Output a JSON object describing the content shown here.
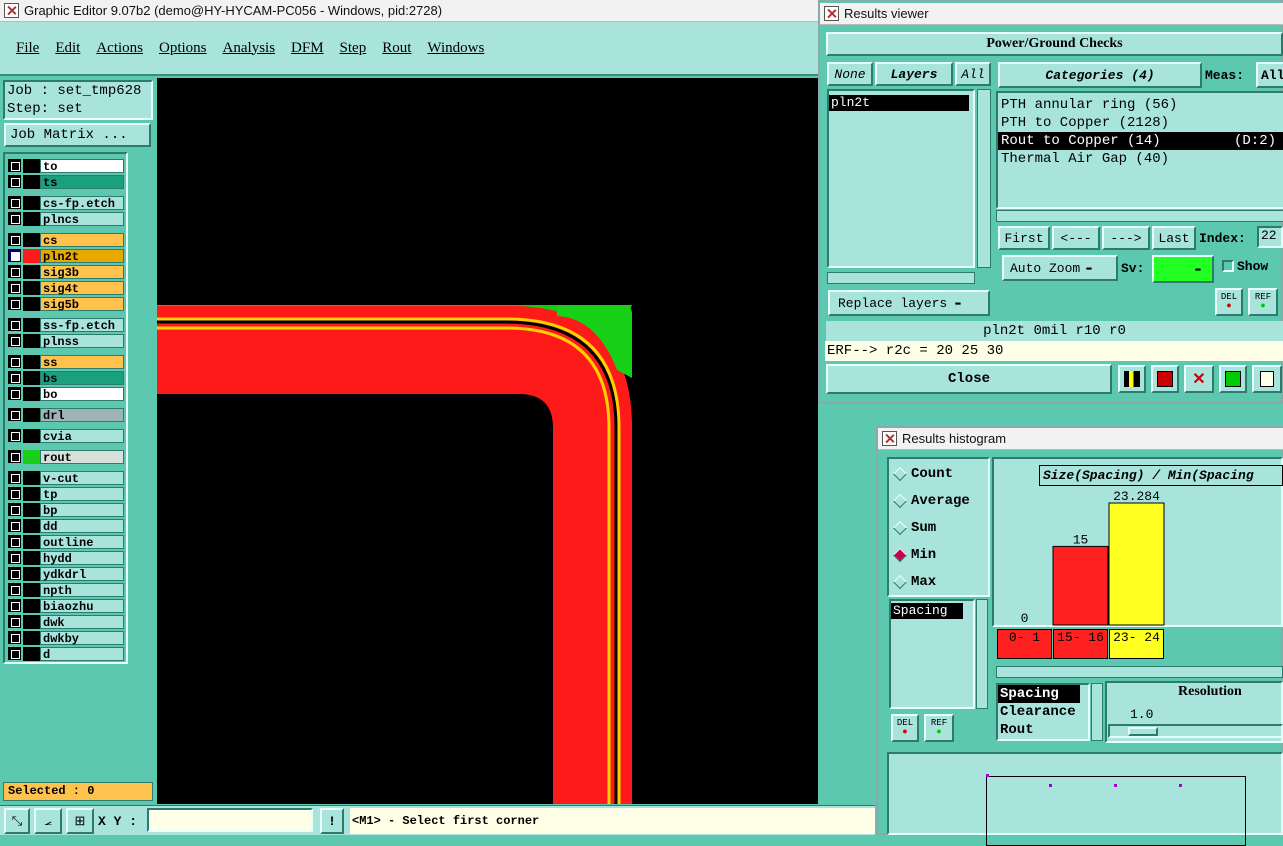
{
  "main_window": {
    "title": "Graphic Editor 9.07b2 (demo@HY-HYCAM-PC056 - Windows, pid:2728)"
  },
  "menu": [
    "File",
    "Edit",
    "Actions",
    "Options",
    "Analysis",
    "DFM",
    "Step",
    "Rout",
    "Windows"
  ],
  "job": {
    "job_label": "Job : set_tmp628",
    "step_label": "Step: set",
    "matrix_button": "Job Matrix ..."
  },
  "layers": [
    {
      "name": "to",
      "color": "#ffffff"
    },
    {
      "name": "ts",
      "color": "#1aa07e"
    },
    {
      "name": "cs-fp.etch",
      "color": "#a8e4db"
    },
    {
      "name": "plncs",
      "color": "#a8e4db"
    },
    {
      "name": "cs",
      "color": "#ffc34d"
    },
    {
      "name": "pln2t",
      "color": "#e8a800",
      "active": true
    },
    {
      "name": "sig3b",
      "color": "#ffc34d"
    },
    {
      "name": "sig4t",
      "color": "#ffc34d"
    },
    {
      "name": "sig5b",
      "color": "#ffc34d"
    },
    {
      "name": "ss-fp.etch",
      "color": "#a8e4db"
    },
    {
      "name": "plnss",
      "color": "#a8e4db"
    },
    {
      "name": "ss",
      "color": "#ffc34d"
    },
    {
      "name": "bs",
      "color": "#1aa07e"
    },
    {
      "name": "bo",
      "color": "#ffffff"
    },
    {
      "name": "drl",
      "color": "#9fb3b8"
    },
    {
      "name": "cvia",
      "color": "#a8e4db"
    },
    {
      "name": "rout",
      "color": "#d8e0dc"
    },
    {
      "name": "v-cut",
      "color": "#a8e4db"
    },
    {
      "name": "tp",
      "color": "#a8e4db"
    },
    {
      "name": "bp",
      "color": "#a8e4db"
    },
    {
      "name": "dd",
      "color": "#a8e4db"
    },
    {
      "name": "outline",
      "color": "#a8e4db"
    },
    {
      "name": "hydd",
      "color": "#a8e4db"
    },
    {
      "name": "ydkdrl",
      "color": "#a8e4db"
    },
    {
      "name": "npth",
      "color": "#a8e4db"
    },
    {
      "name": "biaozhu",
      "color": "#a8e4db"
    },
    {
      "name": "dwk",
      "color": "#a8e4db"
    },
    {
      "name": "dwkby",
      "color": "#a8e4db"
    },
    {
      "name": "d",
      "color": "#a8e4db"
    }
  ],
  "status": {
    "selected": "Selected : 0",
    "xy_label": "X Y :",
    "xy_value": "",
    "prompt": "<M1> - Select first corner"
  },
  "results_viewer": {
    "title": "Results viewer",
    "header": "Power/Ground Checks",
    "btn_none": "None",
    "btn_layers": "Layers",
    "btn_all": "All",
    "layer_list": [
      "pln2t"
    ],
    "categories_label": "Categories (4)",
    "meas_label": "Meas:",
    "meas_value": "All",
    "categories": [
      {
        "text": "PTH annular ring (56)",
        "extra": ""
      },
      {
        "text": "PTH to Copper (2128)",
        "extra": ""
      },
      {
        "text": "Rout to Copper (14)",
        "extra": "(D:2)"
      },
      {
        "text": "Thermal Air Gap (40)",
        "extra": ""
      }
    ],
    "nav": {
      "first": "First",
      "prev": "<---",
      "next": "--->",
      "last": "Last",
      "index_label": "Index:",
      "index_value": "22"
    },
    "auto_zoom": "Auto Zoom",
    "sv_label": "Sv:",
    "show_label": "Show",
    "replace_layers": "Replace layers",
    "del_label": "DEL",
    "ref_label": "REF",
    "info": "pln2t  0mil  r10  r0",
    "erf": "ERF--> r2c = 20 25 30",
    "close": "Close"
  },
  "histogram": {
    "title": "Results histogram",
    "modes": [
      "Count",
      "Average",
      "Sum",
      "Min",
      "Max"
    ],
    "selected_mode": "Min",
    "left_list": [
      "Spacing"
    ],
    "chart_title": "Size(Spacing) / Min(Spacing",
    "measures": [
      "Spacing",
      "Clearance",
      "Rout"
    ],
    "resolution_label": "Resolution",
    "resolution_value": "1.0",
    "del_label": "DEL",
    "ref_label": "REF"
  },
  "chart_data": {
    "type": "bar",
    "title": "Size(Spacing) / Min(Spacing",
    "categories": [
      "0-1",
      "15-16",
      "23-24"
    ],
    "values": [
      0,
      15,
      23.284
    ],
    "value_labels": [
      "0",
      "15",
      "23.284"
    ],
    "colors": [
      "#ff2020",
      "#ff2020",
      "#ffff20"
    ]
  }
}
